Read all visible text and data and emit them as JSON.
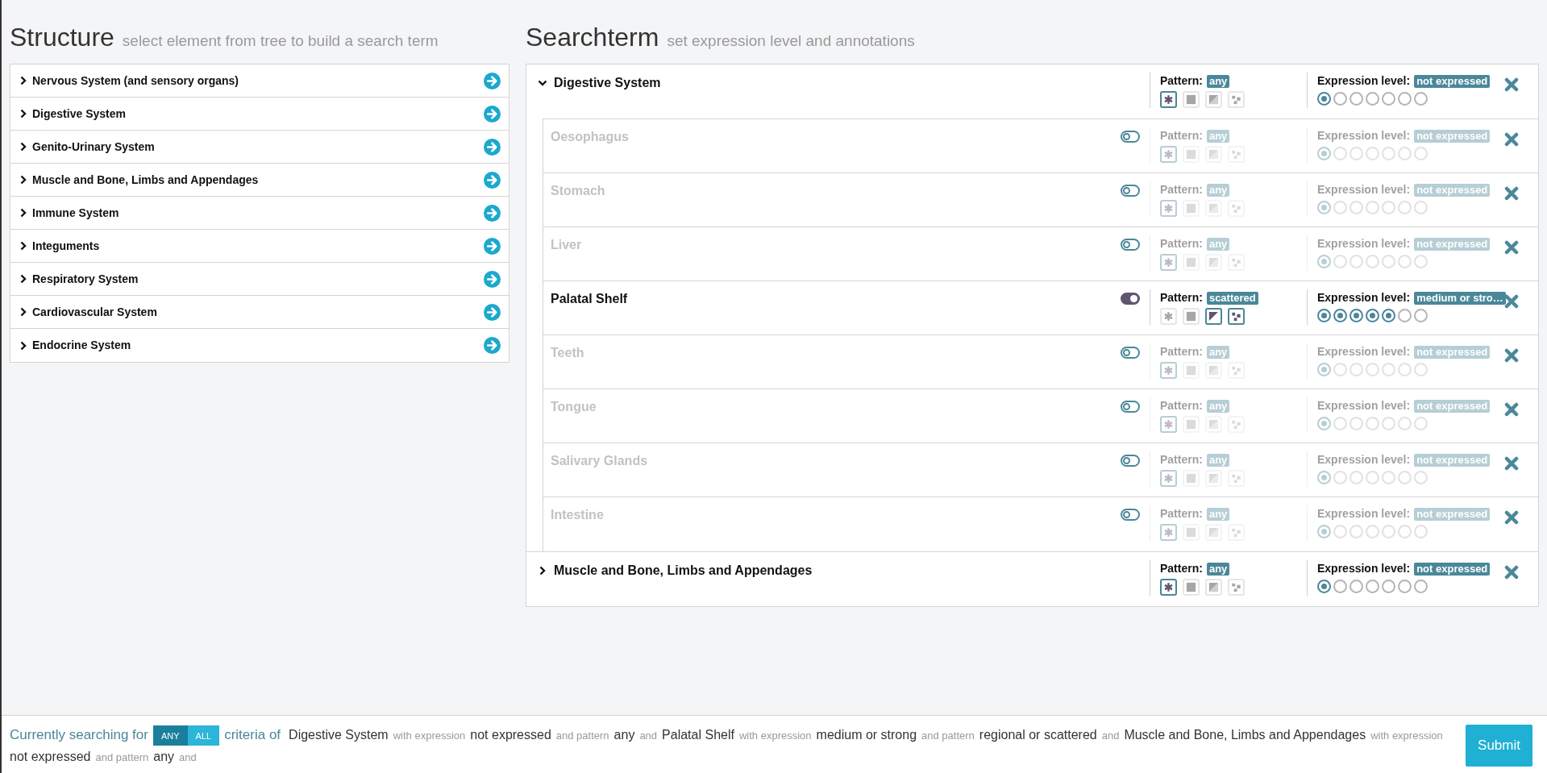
{
  "structure": {
    "title": "Structure",
    "subtitle": "select element from tree to build a search term",
    "items": [
      {
        "label": "Nervous System (and sensory organs)"
      },
      {
        "label": "Digestive System"
      },
      {
        "label": "Genito-Urinary System"
      },
      {
        "label": "Muscle and Bone, Limbs and Appendages"
      },
      {
        "label": "Immune System"
      },
      {
        "label": "Integuments"
      },
      {
        "label": "Respiratory System"
      },
      {
        "label": "Cardiovascular System"
      },
      {
        "label": "Endocrine System"
      }
    ]
  },
  "searchterm": {
    "title": "Searchterm",
    "subtitle": "set expression level and annotations",
    "groups": [
      {
        "name": "Digestive System",
        "expanded": true,
        "pattern_label": "Pattern:",
        "pattern": "any",
        "patterns": [
          {
            "kind": "star",
            "selected": true
          },
          {
            "kind": "square",
            "selected": false
          },
          {
            "kind": "triangle",
            "selected": false
          },
          {
            "kind": "dots",
            "selected": false
          }
        ],
        "expression_label": "Expression level:",
        "expression": "not expressed",
        "levels": [
          {
            "selected": true
          },
          {
            "selected": false
          },
          {
            "selected": false
          },
          {
            "selected": false
          },
          {
            "selected": false
          },
          {
            "selected": false
          },
          {
            "selected": false
          }
        ],
        "children": [
          {
            "name": "Oesophagus",
            "on": false,
            "pattern_label": "Pattern:",
            "pattern": "any",
            "patterns": [
              {
                "kind": "star",
                "selected": true
              },
              {
                "kind": "square",
                "selected": false
              },
              {
                "kind": "triangle",
                "selected": false
              },
              {
                "kind": "dots",
                "selected": false
              }
            ],
            "expression_label": "Expression level:",
            "expression": "not expressed",
            "levels": [
              {
                "selected": true
              },
              {
                "selected": false
              },
              {
                "selected": false
              },
              {
                "selected": false
              },
              {
                "selected": false
              },
              {
                "selected": false
              },
              {
                "selected": false
              }
            ]
          },
          {
            "name": "Stomach",
            "on": false,
            "pattern_label": "Pattern:",
            "pattern": "any",
            "patterns": [
              {
                "kind": "star",
                "selected": true
              },
              {
                "kind": "square",
                "selected": false
              },
              {
                "kind": "triangle",
                "selected": false
              },
              {
                "kind": "dots",
                "selected": false
              }
            ],
            "expression_label": "Expression level:",
            "expression": "not expressed",
            "levels": [
              {
                "selected": true
              },
              {
                "selected": false
              },
              {
                "selected": false
              },
              {
                "selected": false
              },
              {
                "selected": false
              },
              {
                "selected": false
              },
              {
                "selected": false
              }
            ]
          },
          {
            "name": "Liver",
            "on": false,
            "pattern_label": "Pattern:",
            "pattern": "any",
            "patterns": [
              {
                "kind": "star",
                "selected": true
              },
              {
                "kind": "square",
                "selected": false
              },
              {
                "kind": "triangle",
                "selected": false
              },
              {
                "kind": "dots",
                "selected": false
              }
            ],
            "expression_label": "Expression level:",
            "expression": "not expressed",
            "levels": [
              {
                "selected": true
              },
              {
                "selected": false
              },
              {
                "selected": false
              },
              {
                "selected": false
              },
              {
                "selected": false
              },
              {
                "selected": false
              },
              {
                "selected": false
              }
            ]
          },
          {
            "name": "Palatal Shelf",
            "on": true,
            "pattern_label": "Pattern:",
            "pattern": "scattered",
            "patterns": [
              {
                "kind": "star",
                "selected": false
              },
              {
                "kind": "square",
                "selected": false
              },
              {
                "kind": "triangle",
                "selected": true
              },
              {
                "kind": "dots",
                "selected": true
              }
            ],
            "expression_label": "Expression level:",
            "expression": "medium or stro…",
            "levels": [
              {
                "selected": true
              },
              {
                "selected": true
              },
              {
                "selected": true
              },
              {
                "selected": true
              },
              {
                "selected": true
              },
              {
                "selected": false
              },
              {
                "selected": false
              }
            ]
          },
          {
            "name": "Teeth",
            "on": false,
            "pattern_label": "Pattern:",
            "pattern": "any",
            "patterns": [
              {
                "kind": "star",
                "selected": true
              },
              {
                "kind": "square",
                "selected": false
              },
              {
                "kind": "triangle",
                "selected": false
              },
              {
                "kind": "dots",
                "selected": false
              }
            ],
            "expression_label": "Expression level:",
            "expression": "not expressed",
            "levels": [
              {
                "selected": true
              },
              {
                "selected": false
              },
              {
                "selected": false
              },
              {
                "selected": false
              },
              {
                "selected": false
              },
              {
                "selected": false
              },
              {
                "selected": false
              }
            ]
          },
          {
            "name": "Tongue",
            "on": false,
            "pattern_label": "Pattern:",
            "pattern": "any",
            "patterns": [
              {
                "kind": "star",
                "selected": true
              },
              {
                "kind": "square",
                "selected": false
              },
              {
                "kind": "triangle",
                "selected": false
              },
              {
                "kind": "dots",
                "selected": false
              }
            ],
            "expression_label": "Expression level:",
            "expression": "not expressed",
            "levels": [
              {
                "selected": true
              },
              {
                "selected": false
              },
              {
                "selected": false
              },
              {
                "selected": false
              },
              {
                "selected": false
              },
              {
                "selected": false
              },
              {
                "selected": false
              }
            ]
          },
          {
            "name": "Salivary Glands",
            "on": false,
            "pattern_label": "Pattern:",
            "pattern": "any",
            "patterns": [
              {
                "kind": "star",
                "selected": true
              },
              {
                "kind": "square",
                "selected": false
              },
              {
                "kind": "triangle",
                "selected": false
              },
              {
                "kind": "dots",
                "selected": false
              }
            ],
            "expression_label": "Expression level:",
            "expression": "not expressed",
            "levels": [
              {
                "selected": true
              },
              {
                "selected": false
              },
              {
                "selected": false
              },
              {
                "selected": false
              },
              {
                "selected": false
              },
              {
                "selected": false
              },
              {
                "selected": false
              }
            ]
          },
          {
            "name": "Intestine",
            "on": false,
            "pattern_label": "Pattern:",
            "pattern": "any",
            "patterns": [
              {
                "kind": "star",
                "selected": true
              },
              {
                "kind": "square",
                "selected": false
              },
              {
                "kind": "triangle",
                "selected": false
              },
              {
                "kind": "dots",
                "selected": false
              }
            ],
            "expression_label": "Expression level:",
            "expression": "not expressed",
            "levels": [
              {
                "selected": true
              },
              {
                "selected": false
              },
              {
                "selected": false
              },
              {
                "selected": false
              },
              {
                "selected": false
              },
              {
                "selected": false
              },
              {
                "selected": false
              }
            ]
          }
        ]
      },
      {
        "name": "Muscle and Bone, Limbs and Appendages",
        "expanded": false,
        "pattern_label": "Pattern:",
        "pattern": "any",
        "patterns": [
          {
            "kind": "star",
            "selected": true
          },
          {
            "kind": "square",
            "selected": false
          },
          {
            "kind": "triangle",
            "selected": false
          },
          {
            "kind": "dots",
            "selected": false
          }
        ],
        "expression_label": "Expression level:",
        "expression": "not expressed",
        "levels": [
          {
            "selected": true
          },
          {
            "selected": false
          },
          {
            "selected": false
          },
          {
            "selected": false
          },
          {
            "selected": false
          },
          {
            "selected": false
          },
          {
            "selected": false
          }
        ]
      }
    ]
  },
  "footer": {
    "lead": "Currently searching for",
    "modes": [
      {
        "label": "ANY",
        "selected": true
      },
      {
        "label": "ALL",
        "selected": false
      }
    ],
    "criteria": "criteria of",
    "summary": [
      {
        "kind": "term",
        "text": "Digestive System"
      },
      {
        "kind": "connector",
        "text": "with expression"
      },
      {
        "kind": "term",
        "text": "not expressed"
      },
      {
        "kind": "connector",
        "text": "and pattern"
      },
      {
        "kind": "term",
        "text": "any"
      },
      {
        "kind": "connector",
        "text": "and"
      },
      {
        "kind": "term",
        "text": "Palatal Shelf"
      },
      {
        "kind": "connector",
        "text": "with expression"
      },
      {
        "kind": "term",
        "text": "medium or strong"
      },
      {
        "kind": "connector",
        "text": "and pattern"
      },
      {
        "kind": "term",
        "text": "regional or scattered"
      },
      {
        "kind": "connector",
        "text": "and"
      },
      {
        "kind": "term",
        "text": "Muscle and Bone, Limbs and Appendages"
      },
      {
        "kind": "connector",
        "text": "with expression"
      },
      {
        "kind": "term",
        "text": "not expressed"
      },
      {
        "kind": "connector",
        "text": "and pattern"
      },
      {
        "kind": "term",
        "text": "any"
      },
      {
        "kind": "connector",
        "text": "and"
      }
    ],
    "submit": "Submit"
  }
}
